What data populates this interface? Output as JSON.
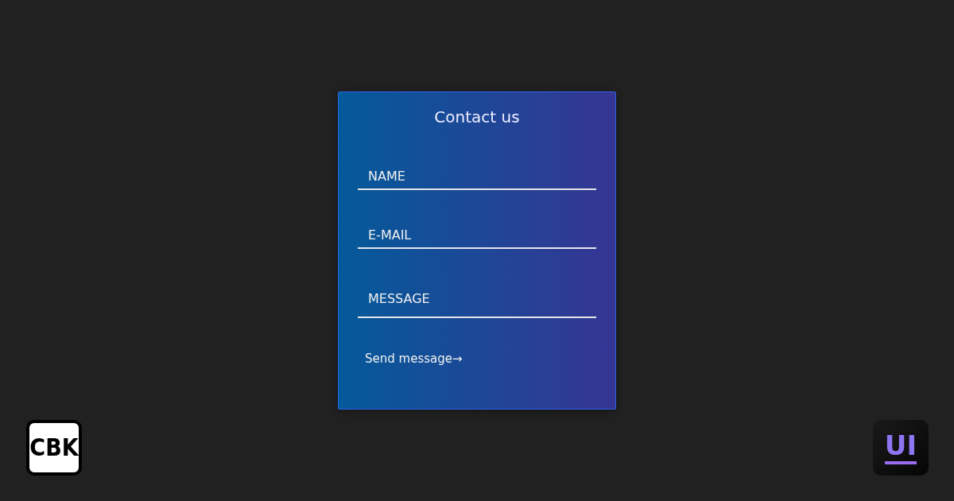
{
  "form": {
    "title": "Contact us",
    "fields": [
      {
        "kind": "input",
        "placeholder": "NAME"
      },
      {
        "kind": "input",
        "placeholder": "E-MAIL"
      },
      {
        "kind": "textarea",
        "placeholder": "MESSAGE"
      }
    ],
    "submit": "Send message→"
  },
  "logos": {
    "left": "CBK",
    "right": "UI"
  }
}
